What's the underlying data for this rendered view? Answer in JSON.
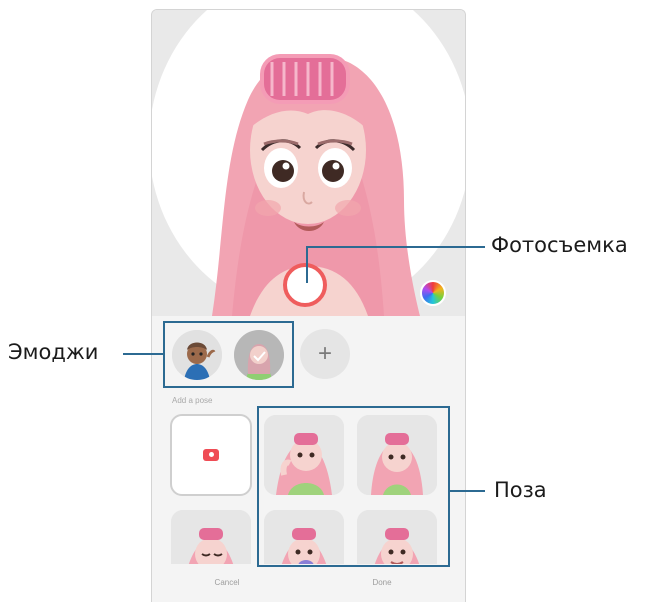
{
  "screen": {
    "emoji_section_label": "Add a pose",
    "cancel_label": "Cancel",
    "done_label": "Done",
    "add_emoji_label": "+"
  },
  "callouts": {
    "capture": "Фотосъемка",
    "emoji": "Эмоджи",
    "pose": "Поза"
  },
  "colors": {
    "accent_capture": "#ef5d5d",
    "callout_line": "#2c6a92",
    "hair": "#f4a9b8",
    "skin": "#f6d3cf",
    "shirt": "#9fd27c"
  },
  "icons": {
    "palette": "color-palette-icon",
    "camera": "camera-icon",
    "add": "plus-icon"
  }
}
